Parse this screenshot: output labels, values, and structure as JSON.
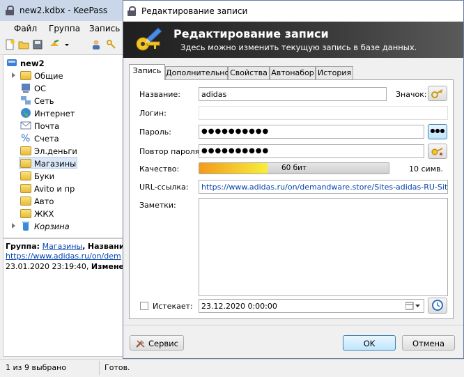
{
  "main": {
    "title": "new2.kdbx - KeePass",
    "menu": [
      "Файл",
      "Группа",
      "Запись"
    ],
    "tree": {
      "root": "new2",
      "groups": [
        {
          "label": "Общие",
          "icon": "folder-icon",
          "italic": false
        },
        {
          "label": "ОС",
          "icon": "os-icon",
          "italic": false
        },
        {
          "label": "Сеть",
          "icon": "network-icon",
          "italic": false
        },
        {
          "label": "Интернет",
          "icon": "globe-icon",
          "italic": false
        },
        {
          "label": "Почта",
          "icon": "mail-icon",
          "italic": false
        },
        {
          "label": "Счета",
          "icon": "percent-icon",
          "italic": false
        },
        {
          "label": "Эл.деньги",
          "icon": "folder-icon",
          "italic": false
        },
        {
          "label": "Магазины",
          "icon": "folder-icon",
          "italic": false,
          "selected": true
        },
        {
          "label": "Буки",
          "icon": "folder-icon",
          "italic": false
        },
        {
          "label": "Avito и пр",
          "icon": "folder-icon",
          "italic": false
        },
        {
          "label": "Авто",
          "icon": "folder-icon",
          "italic": false
        },
        {
          "label": "ЖКХ",
          "icon": "folder-icon",
          "italic": false
        },
        {
          "label": "Корзина",
          "icon": "recycle-bin-icon",
          "italic": true
        }
      ]
    },
    "info": {
      "group_label": "Группа:",
      "group_value": "Магазины",
      "title_label": "Название:",
      "url": "https://www.adidas.ru/on/dem",
      "created": "23.01.2020 23:19:40,",
      "modified_label": "Изменено:"
    },
    "status": {
      "selection": "1 из 9 выбрано",
      "state": "Готов."
    }
  },
  "dialog": {
    "title": "Редактирование записи",
    "banner_title": "Редактирование записи",
    "banner_subtitle": "Здесь можно изменить текущую запись в базе данных.",
    "tabs": [
      "Запись",
      "Дополнительно",
      "Свойства",
      "Автонабор",
      "История"
    ],
    "fields": {
      "title_label": "Название:",
      "title_value": "adidas",
      "icon_label": "Значок:",
      "login_label": "Логин:",
      "login_value": "",
      "password_label": "Пароль:",
      "password_value": "●●●●●●●●●●",
      "repeat_label": "Повтор пароля:",
      "repeat_value": "●●●●●●●●●●",
      "quality_label": "Качество:",
      "quality_bits": "60 бит",
      "quality_fraction": 0.6,
      "quality_chars": "10 симв.",
      "url_label": "URL-ссылка:",
      "url_value": "https://www.adidas.ru/on/demandware.store/Sites-adidas-RU-Site/ru_RU",
      "notes_label": "Заметки:",
      "notes_value": "",
      "expires_label": "Истекает:",
      "expires_value": "23.12.2020   0:00:00",
      "expires_checked": false
    },
    "buttons": {
      "tools": "Сервис",
      "ok": "OK",
      "cancel": "Отмена",
      "show_password": "●●●"
    }
  },
  "colors": {
    "banner_dark": "#1f1f1f",
    "quality_start": "#f39a1c",
    "quality_end": "#f7ef3b",
    "link": "#0645ad",
    "selected_bg": "#dbe8f8"
  }
}
